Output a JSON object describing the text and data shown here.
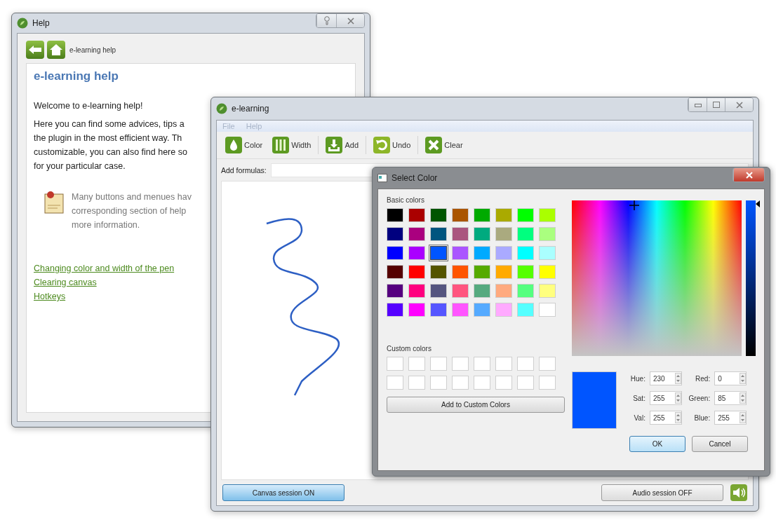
{
  "help_window": {
    "title": "Help",
    "toolbar_label": "e-learning help",
    "heading": "e-learning help",
    "welcome": "Welcome to e-learning help!",
    "paragraph_lines": [
      "Here you can find some advices, tips a",
      "the plugin in the most efficient way. Th",
      "customizable, you can also find here so",
      "for your particular case."
    ],
    "note_lines": [
      "Many buttons and menues hav",
      "corresponding section of help",
      "more information."
    ],
    "links": [
      "Changing color and width of the pen",
      "Clearing canvas",
      "Hotkeys"
    ]
  },
  "main_window": {
    "title": "e-learning",
    "menu": [
      "File",
      "Help"
    ],
    "toolbar": [
      {
        "label": "Color",
        "kind": "color"
      },
      {
        "label": "Width",
        "kind": "width"
      },
      {
        "label": "Add",
        "kind": "add"
      },
      {
        "label": "Undo",
        "kind": "undo"
      },
      {
        "label": "Clear",
        "kind": "clear"
      }
    ],
    "formula_label": "Add formulas:",
    "canvas_button": {
      "label": "Canvas session ON",
      "on": true
    },
    "audio_button": {
      "label": "Audio session OFF",
      "on": false
    }
  },
  "color_dialog": {
    "title": "Select Color",
    "basic_label": "Basic colors",
    "basic_colors": [
      {
        "color": "#000000",
        "selected": false
      },
      {
        "color": "#aa0000",
        "selected": false
      },
      {
        "color": "#005500",
        "selected": false
      },
      {
        "color": "#aa5500",
        "selected": false
      },
      {
        "color": "#00aa00",
        "selected": false
      },
      {
        "color": "#aaaa00",
        "selected": false
      },
      {
        "color": "#00ff00",
        "selected": false
      },
      {
        "color": "#aaff00",
        "selected": false
      },
      {
        "color": "#00007f",
        "selected": false
      },
      {
        "color": "#aa007f",
        "selected": false
      },
      {
        "color": "#00557f",
        "selected": false
      },
      {
        "color": "#aa557f",
        "selected": false
      },
      {
        "color": "#00aa7f",
        "selected": false
      },
      {
        "color": "#aaaa7f",
        "selected": false
      },
      {
        "color": "#00ff7f",
        "selected": false
      },
      {
        "color": "#aaff7f",
        "selected": false
      },
      {
        "color": "#0000ff",
        "selected": false
      },
      {
        "color": "#aa00ff",
        "selected": false
      },
      {
        "color": "#0055ff",
        "selected": true
      },
      {
        "color": "#aa55ff",
        "selected": false
      },
      {
        "color": "#00aaff",
        "selected": false
      },
      {
        "color": "#aaaaff",
        "selected": false
      },
      {
        "color": "#00ffff",
        "selected": false
      },
      {
        "color": "#aaffff",
        "selected": false
      },
      {
        "color": "#550000",
        "selected": false
      },
      {
        "color": "#ff0000",
        "selected": false
      },
      {
        "color": "#555500",
        "selected": false
      },
      {
        "color": "#ff5500",
        "selected": false
      },
      {
        "color": "#55aa00",
        "selected": false
      },
      {
        "color": "#ffaa00",
        "selected": false
      },
      {
        "color": "#55ff00",
        "selected": false
      },
      {
        "color": "#ffff00",
        "selected": false
      },
      {
        "color": "#55007f",
        "selected": false
      },
      {
        "color": "#ff007f",
        "selected": false
      },
      {
        "color": "#55557f",
        "selected": false
      },
      {
        "color": "#ff557f",
        "selected": false
      },
      {
        "color": "#55aa7f",
        "selected": false
      },
      {
        "color": "#ffaa7f",
        "selected": false
      },
      {
        "color": "#55ff7f",
        "selected": false
      },
      {
        "color": "#ffff7f",
        "selected": false
      },
      {
        "color": "#5500ff",
        "selected": false
      },
      {
        "color": "#ff00ff",
        "selected": false
      },
      {
        "color": "#5555ff",
        "selected": false
      },
      {
        "color": "#ff55ff",
        "selected": false
      },
      {
        "color": "#55aaff",
        "selected": false
      },
      {
        "color": "#ffaaff",
        "selected": false
      },
      {
        "color": "#55ffff",
        "selected": false
      },
      {
        "color": "#ffffff",
        "selected": false
      }
    ],
    "custom_label": "Custom colors",
    "custom_colors": [
      {
        "color": "#ffffff"
      },
      {
        "color": "#ffffff"
      },
      {
        "color": "#ffffff"
      },
      {
        "color": "#ffffff"
      },
      {
        "color": "#ffffff"
      },
      {
        "color": "#ffffff"
      },
      {
        "color": "#ffffff"
      },
      {
        "color": "#ffffff"
      },
      {
        "color": "#ffffff"
      },
      {
        "color": "#ffffff"
      },
      {
        "color": "#ffffff"
      },
      {
        "color": "#ffffff"
      },
      {
        "color": "#ffffff"
      },
      {
        "color": "#ffffff"
      },
      {
        "color": "#ffffff"
      },
      {
        "color": "#ffffff"
      }
    ],
    "add_custom_button": "Add to Custom Colors",
    "fields": [
      {
        "label": "Hue:",
        "value": "230"
      },
      {
        "label": "Red:",
        "value": "0"
      },
      {
        "label": "Sat:",
        "value": "255"
      },
      {
        "label": "Green:",
        "value": "85"
      },
      {
        "label": "Val:",
        "value": "255"
      },
      {
        "label": "Blue:",
        "value": "255"
      }
    ],
    "ok": "OK",
    "cancel": "Cancel"
  }
}
